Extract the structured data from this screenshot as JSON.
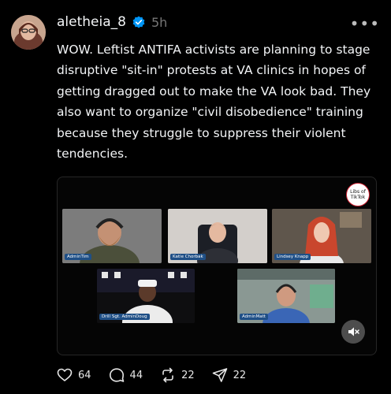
{
  "post": {
    "username": "aletheia_8",
    "time": "5h",
    "more_icon": "more-horizontal-icon",
    "text": "WOW. Leftist ANTIFA activists are planning to stage disruptive \"sit-in\" protests at VA clinics in hopes of getting dragged out to make the VA look bad. They also want to organize \"civil disobedience\" training because they struggle to suppress their violent tendencies."
  },
  "video": {
    "watermark_line1": "Libs of",
    "watermark_line2": "TikTok",
    "participants": [
      "AdminTim",
      "Katie Chorbak",
      "Lindsey Knapp",
      "Drill Sgt. AdminDoug",
      "AdminMatt"
    ]
  },
  "actions": {
    "likes": "64",
    "replies": "44",
    "reposts": "22",
    "shares": "22"
  },
  "colors": {
    "background": "#000000",
    "verified": "#0095f6",
    "label": "#1f4f86"
  }
}
